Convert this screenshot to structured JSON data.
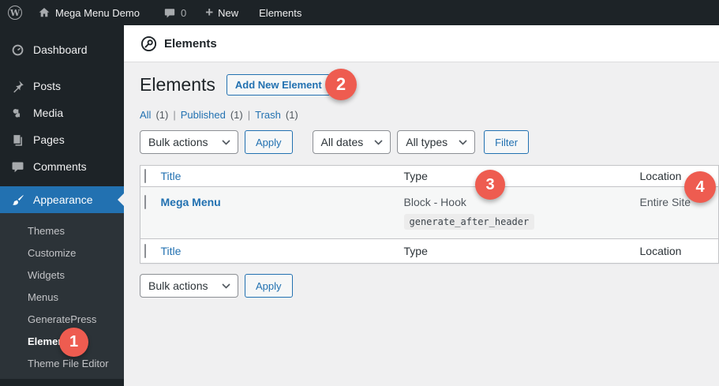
{
  "admin_bar": {
    "wp_logo_letter": "W",
    "site_name": "Mega Menu Demo",
    "comments_count": "0",
    "new_label": "New",
    "current_page": "Elements"
  },
  "sidebar": {
    "items": [
      {
        "label": "Dashboard"
      },
      {
        "label": "Posts"
      },
      {
        "label": "Media"
      },
      {
        "label": "Pages"
      },
      {
        "label": "Comments"
      },
      {
        "label": "Appearance"
      }
    ],
    "submenu": [
      {
        "label": "Themes"
      },
      {
        "label": "Customize"
      },
      {
        "label": "Widgets"
      },
      {
        "label": "Menus"
      },
      {
        "label": "GeneratePress"
      },
      {
        "label": "Elements"
      },
      {
        "label": "Theme File Editor"
      }
    ]
  },
  "page": {
    "header_title": "Elements",
    "heading": "Elements",
    "add_new_label": "Add New Element"
  },
  "views": {
    "separator": "|",
    "items": [
      {
        "label": "All",
        "count": "(1)"
      },
      {
        "label": "Published",
        "count": "(1)"
      },
      {
        "label": "Trash",
        "count": "(1)"
      }
    ]
  },
  "tablenav": {
    "bulk_actions": "Bulk actions",
    "apply_label": "Apply",
    "all_dates": "All dates",
    "all_types": "All types",
    "filter_label": "Filter"
  },
  "table": {
    "headers": {
      "title": "Title",
      "type": "Type",
      "location": "Location"
    },
    "rows": [
      {
        "title": "Mega Menu",
        "type": "Block - Hook",
        "hook": "generate_after_header",
        "location": "Entire Site"
      }
    ]
  },
  "badges": [
    {
      "number": "1"
    },
    {
      "number": "2"
    },
    {
      "number": "3"
    },
    {
      "number": "4"
    }
  ],
  "colors": {
    "accent_blue": "#2271b1",
    "badge_red": "#ee5c50",
    "admin_dark": "#1d2327",
    "submenu_dark": "#2c3338",
    "content_bg": "#f0f0f1",
    "row_stripe": "#f6f7f7"
  }
}
